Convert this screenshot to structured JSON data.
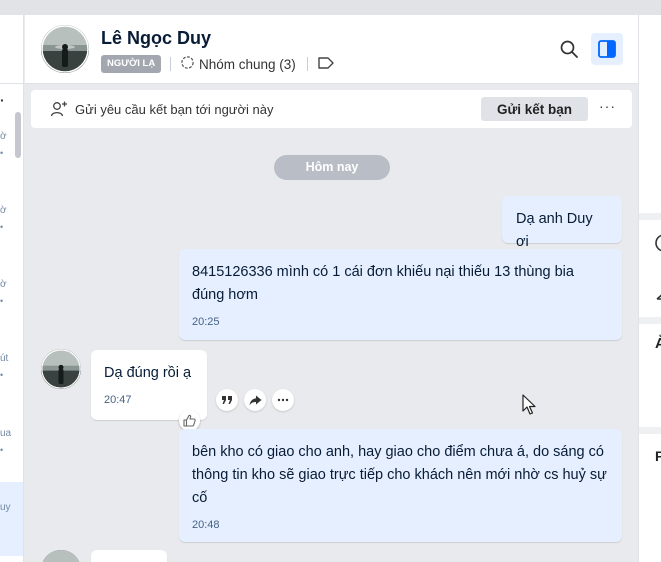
{
  "contact": {
    "name": "Lê Ngọc Duy",
    "stranger_badge": "NGƯỜI LẠ",
    "common_groups": "Nhóm chung (3)"
  },
  "friend_request": {
    "text": "Gửi yêu cầu kết bạn tới người này",
    "button_label": "Gửi kết bạn",
    "more_label": "···"
  },
  "date_divider": "Hôm nay",
  "messages": [
    {
      "sender": "me",
      "text": "Dạ anh Duy ơi",
      "time": ""
    },
    {
      "sender": "me",
      "text": "8415126336 mình có 1 cái đơn khiếu nại thiếu 13 thùng bia đúng hơm",
      "time": "20:25"
    },
    {
      "sender": "them",
      "text": "Dạ đúng rồi ạ",
      "time": "20:47"
    },
    {
      "sender": "me",
      "text": "bên kho có giao cho anh, hay giao cho điểm chưa á, do sáng có thông tin kho sẽ giao trực tiếp cho khách nên mới nhờ cs huỷ sự cố",
      "time": "20:48"
    }
  ],
  "left_list_fragments": [
    "ờ",
    "ờ",
    "ờ",
    "út",
    "ua",
    "uy"
  ],
  "right_panel_glyphs": [
    "Ả",
    "F"
  ],
  "colors": {
    "accent": "#0068ff",
    "my_bubble": "#e5efff",
    "their_bubble": "#ffffff",
    "chat_background": "#e8eaed",
    "stranger_badge": "#a3a8b0",
    "date_pill": "#b9bec6"
  },
  "icons": {
    "header_search": "search-icon",
    "header_panel": "sidebar-toggle-icon",
    "group": "group-icon",
    "tag": "tag-icon",
    "add_friend": "add-user-icon",
    "reaction": "thumbs-up-icon",
    "quote": "quote-icon",
    "share": "share-icon",
    "more": "more-icon"
  }
}
